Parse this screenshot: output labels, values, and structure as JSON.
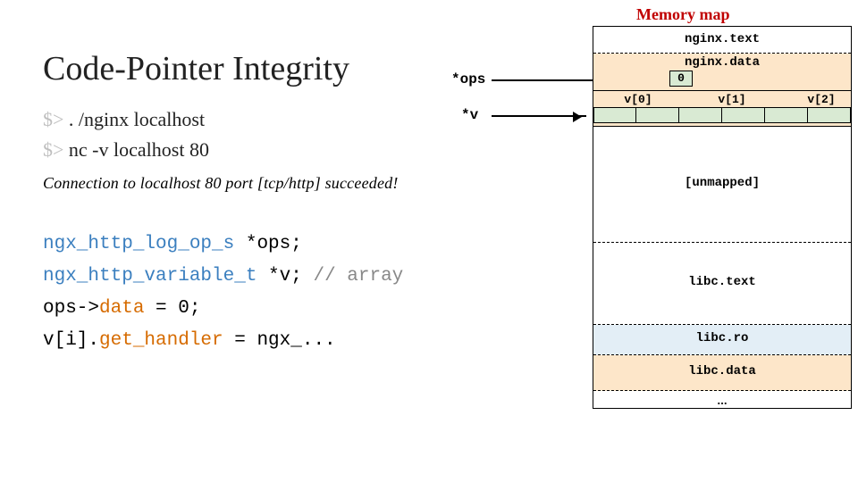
{
  "title": "Code-Pointer Integrity",
  "shell": {
    "prompt": "$> ",
    "line1_cmd": ". /nginx localhost",
    "line2_cmd": "nc -v localhost 80",
    "connection": "Connection to localhost 80 port [tcp/http] succeeded!"
  },
  "code": {
    "l1_type": "ngx_http_log_op_s",
    "l1_rest": " *ops;",
    "l2_type": "ngx_http_variable_t",
    "l2_rest": " *v; ",
    "l2_comment": "// array",
    "l3_pre": "ops->",
    "l3_field": "data",
    "l3_post": " = 0;",
    "l4_pre": "v[i].",
    "l4_field": "get_handler",
    "l4_post": " = ngx_..."
  },
  "pointers": {
    "ops": "*ops",
    "v": "*v"
  },
  "mem": {
    "title": "Memory map",
    "nginx_text": "nginx.text",
    "nginx_data": "nginx.data",
    "unmapped": "[unmapped]",
    "libc_text": "libc.text",
    "libc_ro": "libc.ro",
    "libc_data": "libc.data",
    "dots": "...",
    "cell_zero": "0",
    "v0": "v[0]",
    "v1": "v[1]",
    "v2": "v[2]"
  }
}
